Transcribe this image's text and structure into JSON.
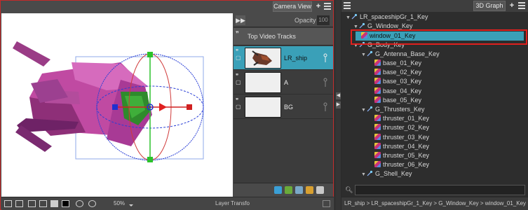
{
  "camera_view": {
    "tab_label": "Camera View",
    "opacity_label": "Opacity",
    "opacity_value": "100",
    "track_header": "Top Video Tracks",
    "layers": [
      {
        "name": "LR_ship",
        "selected": true
      },
      {
        "name": "A",
        "selected": false
      },
      {
        "name": "BG",
        "selected": false
      }
    ],
    "status": {
      "zoom": "50%",
      "mode": "Layer Transfo"
    }
  },
  "graph3d": {
    "tab_label": "3D Graph",
    "tree": [
      {
        "label": "LR_spaceshipGr_1_Key",
        "depth": 0,
        "twisty": "open",
        "icon": "peg-icon"
      },
      {
        "label": "G_Window_Key",
        "depth": 1,
        "twisty": "open",
        "icon": "peg-icon"
      },
      {
        "label": "window_01_Key",
        "depth": 2,
        "twisty": "",
        "icon": "mesh-icon",
        "selected": true
      },
      {
        "label": "G_Body_Key",
        "depth": 1,
        "twisty": "open",
        "icon": "peg-icon"
      },
      {
        "label": "G_Antenna_Base_Key",
        "depth": 2,
        "twisty": "open",
        "icon": "peg-icon"
      },
      {
        "label": "base_01_Key",
        "depth": 3,
        "twisty": "",
        "icon": "mesh-icon"
      },
      {
        "label": "base_02_Key",
        "depth": 3,
        "twisty": "",
        "icon": "mesh-icon"
      },
      {
        "label": "base_03_Key",
        "depth": 3,
        "twisty": "",
        "icon": "mesh-icon"
      },
      {
        "label": "base_04_Key",
        "depth": 3,
        "twisty": "",
        "icon": "mesh-icon"
      },
      {
        "label": "base_05_Key",
        "depth": 3,
        "twisty": "",
        "icon": "mesh-icon"
      },
      {
        "label": "G_Thrusters_Key",
        "depth": 2,
        "twisty": "open",
        "icon": "peg-icon"
      },
      {
        "label": "thruster_01_Key",
        "depth": 3,
        "twisty": "",
        "icon": "mesh-icon"
      },
      {
        "label": "thruster_02_Key",
        "depth": 3,
        "twisty": "",
        "icon": "mesh-icon"
      },
      {
        "label": "thruster_03_Key",
        "depth": 3,
        "twisty": "",
        "icon": "mesh-icon"
      },
      {
        "label": "thruster_04_Key",
        "depth": 3,
        "twisty": "",
        "icon": "mesh-icon"
      },
      {
        "label": "thruster_05_Key",
        "depth": 3,
        "twisty": "",
        "icon": "mesh-icon"
      },
      {
        "label": "thruster_06_Key",
        "depth": 3,
        "twisty": "",
        "icon": "mesh-icon"
      },
      {
        "label": "G_Shell_Key",
        "depth": 2,
        "twisty": "open",
        "icon": "peg-icon"
      }
    ],
    "path": "LR_ship > LR_spaceshipGr_1_Key > G_Window_Key > window_01_Key"
  },
  "colors": {
    "selection": "#3aa0b8",
    "highlight_outline": "#e0201e",
    "window_border": "#c32a2a"
  }
}
